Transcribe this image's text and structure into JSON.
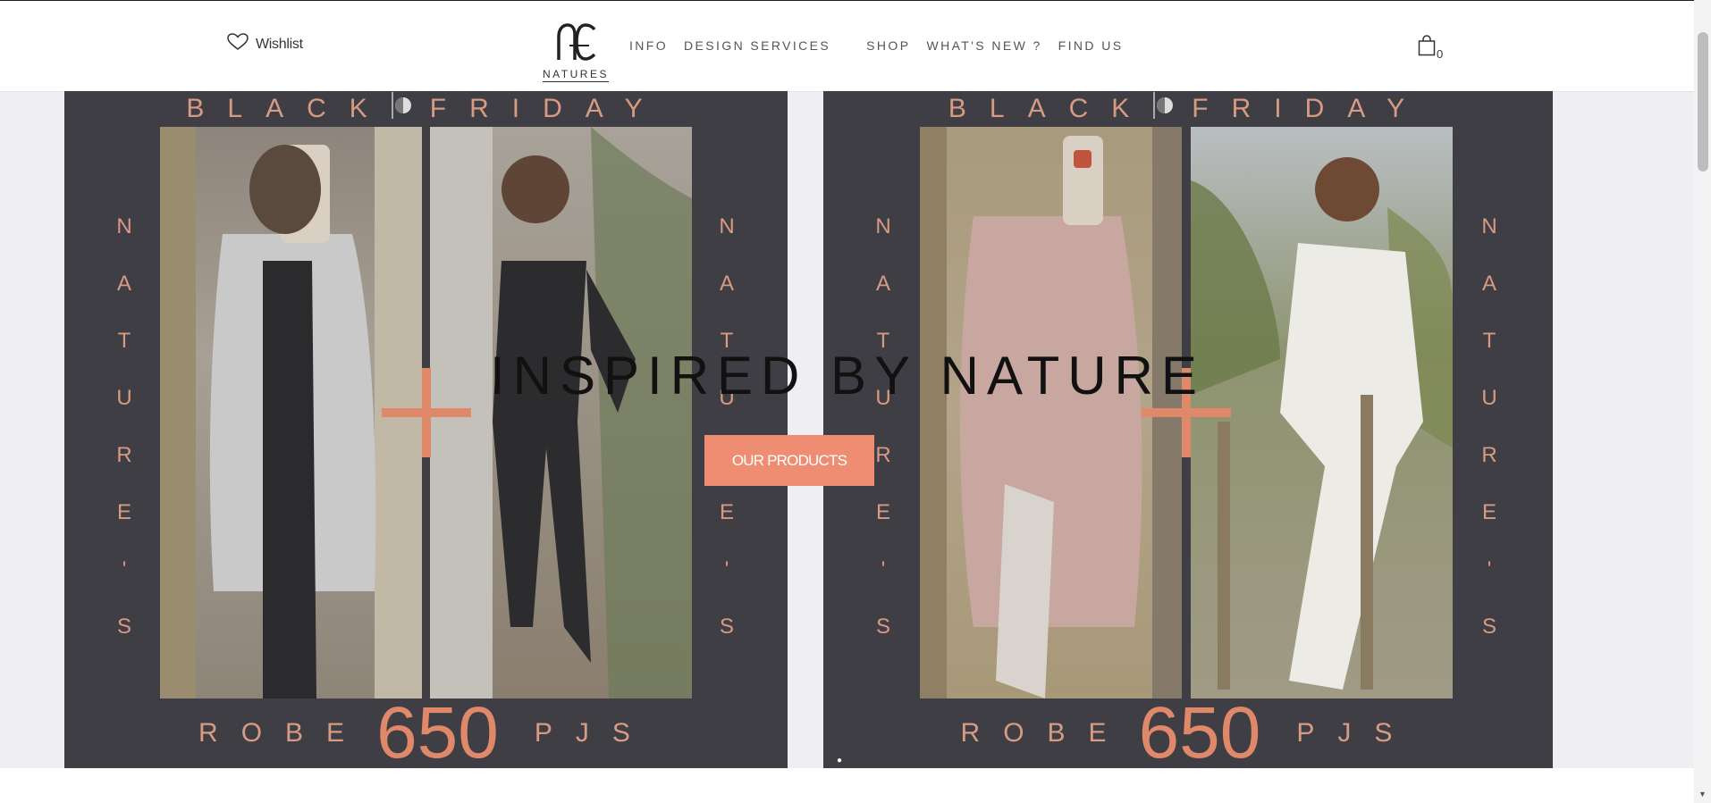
{
  "header": {
    "wishlist_label": "Wishlist",
    "logo_text": "NATURES",
    "nav": [
      "INFO",
      "DESIGN SERVICES",
      "SHOP",
      "WHAT'S NEW ?",
      "FIND US"
    ],
    "cart_count": "0"
  },
  "promo": {
    "banner_left": "BLACK",
    "banner_right": "FRIDAY",
    "side_letters": [
      "N",
      "A",
      "T",
      "U",
      "R",
      "E",
      "'",
      "S"
    ],
    "robe": "ROBE",
    "price": "650",
    "pjs": "PJS"
  },
  "hero": {
    "title": "INSPIRED BY NATURE",
    "cta": "OUR PRODUCTS"
  },
  "colors": {
    "accent": "#ee8d72",
    "panel": "#3f3e44",
    "promo_text": "#d79a83"
  }
}
